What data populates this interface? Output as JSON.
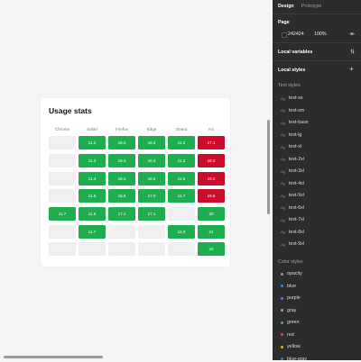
{
  "card": {
    "title": "Usage stats",
    "columns": [
      "Chrome",
      "Safari",
      "Firefox",
      "Edge",
      "Opera",
      "Arc"
    ],
    "rows": [
      [
        {
          "v": "",
          "c": "empty"
        },
        {
          "v": "11.2",
          "c": "green"
        },
        {
          "v": "16.2",
          "c": "green"
        },
        {
          "v": "16.2",
          "c": "green"
        },
        {
          "v": "11.2",
          "c": "green"
        },
        {
          "v": "17.1",
          "c": "red"
        }
      ],
      [
        {
          "v": "",
          "c": "empty"
        },
        {
          "v": "11.3",
          "c": "green"
        },
        {
          "v": "16.3",
          "c": "green"
        },
        {
          "v": "16.3",
          "c": "green"
        },
        {
          "v": "11.3",
          "c": "green"
        },
        {
          "v": "18.2",
          "c": "red"
        }
      ],
      [
        {
          "v": "",
          "c": "empty"
        },
        {
          "v": "11.4",
          "c": "green"
        },
        {
          "v": "16.4",
          "c": "green"
        },
        {
          "v": "16.5",
          "c": "green"
        },
        {
          "v": "11.5",
          "c": "green"
        },
        {
          "v": "19.2",
          "c": "red"
        }
      ],
      [
        {
          "v": "",
          "c": "empty"
        },
        {
          "v": "11.5",
          "c": "green"
        },
        {
          "v": "16.6",
          "c": "green"
        },
        {
          "v": "17.0",
          "c": "green"
        },
        {
          "v": "11.7",
          "c": "green"
        },
        {
          "v": "19.5",
          "c": "red"
        }
      ],
      [
        {
          "v": "11.7",
          "c": "green"
        },
        {
          "v": "11.6",
          "c": "green"
        },
        {
          "v": "17.1",
          "c": "green"
        },
        {
          "v": "17.1",
          "c": "green"
        },
        {
          "v": "",
          "c": "empty"
        },
        {
          "v": "20",
          "c": "green"
        }
      ],
      [
        {
          "v": "",
          "c": "empty"
        },
        {
          "v": "11.7",
          "c": "green"
        },
        {
          "v": "",
          "c": "empty"
        },
        {
          "v": "",
          "c": "empty"
        },
        {
          "v": "12.0",
          "c": "green"
        },
        {
          "v": "21",
          "c": "green"
        }
      ],
      [
        {
          "v": "",
          "c": "empty"
        },
        {
          "v": "",
          "c": "empty"
        },
        {
          "v": "",
          "c": "empty"
        },
        {
          "v": "",
          "c": "empty"
        },
        {
          "v": "",
          "c": "empty"
        },
        {
          "v": "22",
          "c": "green"
        }
      ]
    ]
  },
  "panel": {
    "tabs": {
      "design": "Design",
      "prototype": "Prototype"
    },
    "page": {
      "title": "Page",
      "color": "242424",
      "opacity": "100%",
      "swatch": "#242424"
    },
    "local_variables": "Local variables",
    "local_styles": "Local styles",
    "text_styles_label": "Text styles",
    "text_styles": [
      "text-xs",
      "text-sm",
      "text-base",
      "text-lg",
      "text-xl",
      "text-2xl",
      "text-3xl",
      "text-4xl",
      "text-5xl",
      "text-6xl",
      "text-7xl",
      "text-8xl",
      "text-9xl"
    ],
    "color_styles_label": "Color styles",
    "color_styles": [
      {
        "name": "opacity",
        "color": "#9a9a9a"
      },
      {
        "name": "blue",
        "color": "#3b82f6"
      },
      {
        "name": "purple",
        "color": "#8b5cf6"
      },
      {
        "name": "gray",
        "color": "#9ca3af"
      },
      {
        "name": "green",
        "color": "#22c55e"
      },
      {
        "name": "red",
        "color": "#ef4444"
      },
      {
        "name": "yellow",
        "color": "#eab308"
      },
      {
        "name": "blue-gray",
        "color": "#64748b"
      }
    ]
  },
  "colors": {
    "green": "#1fae4f",
    "red": "#cc0c2b",
    "panel_bg": "#2c2c2c",
    "canvas_bg": "#f5f5f5"
  }
}
